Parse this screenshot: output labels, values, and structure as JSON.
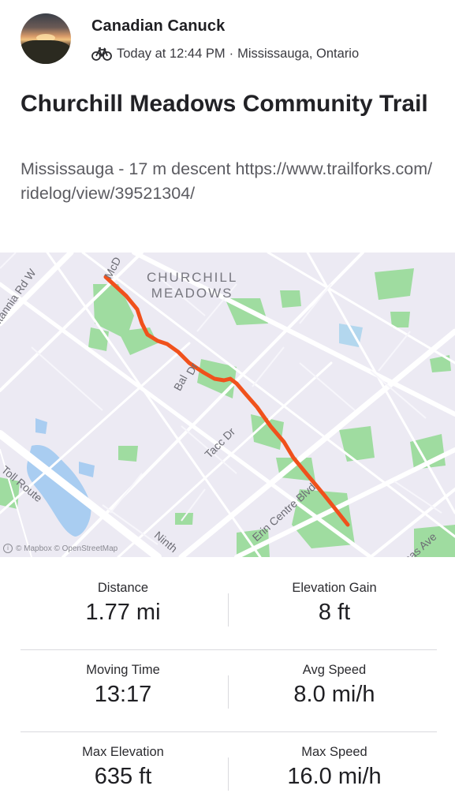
{
  "athlete": {
    "name": "Canadian Canuck",
    "activity_icon": "bike-icon",
    "timestamp": "Today at 12:44 PM",
    "separator": "·",
    "location": "Mississauga, Ontario"
  },
  "activity": {
    "title": "Churchill Meadows Community Trail",
    "description": "Mississauga - 17 m descent https://www.trailforks.com/ridelog/view/39521304/"
  },
  "map": {
    "area_label_line1": "CHURCHILL",
    "area_label_line2": "MEADOWS",
    "streets": {
      "britannia": "itannia Rd W",
      "mcd": "McD",
      "bal": "Bal",
      "dr": "Dr",
      "tacc": "Tacc Dr",
      "erin": "Erin Centre Blvd",
      "toll": "Toll Route",
      "ninth": "Ninth",
      "ave": "inas Ave"
    },
    "attribution": "© Mapbox © OpenStreetMap",
    "route_color": "#f0511c",
    "park_color": "#9fdca0",
    "water_color": "#a9cdf1"
  },
  "stats": [
    {
      "label": "Distance",
      "value": "1.77 mi"
    },
    {
      "label": "Elevation Gain",
      "value": "8 ft"
    },
    {
      "label": "Moving Time",
      "value": "13:17"
    },
    {
      "label": "Avg Speed",
      "value": "8.0 mi/h"
    },
    {
      "label": "Max Elevation",
      "value": "635 ft"
    },
    {
      "label": "Max Speed",
      "value": "16.0 mi/h"
    }
  ]
}
